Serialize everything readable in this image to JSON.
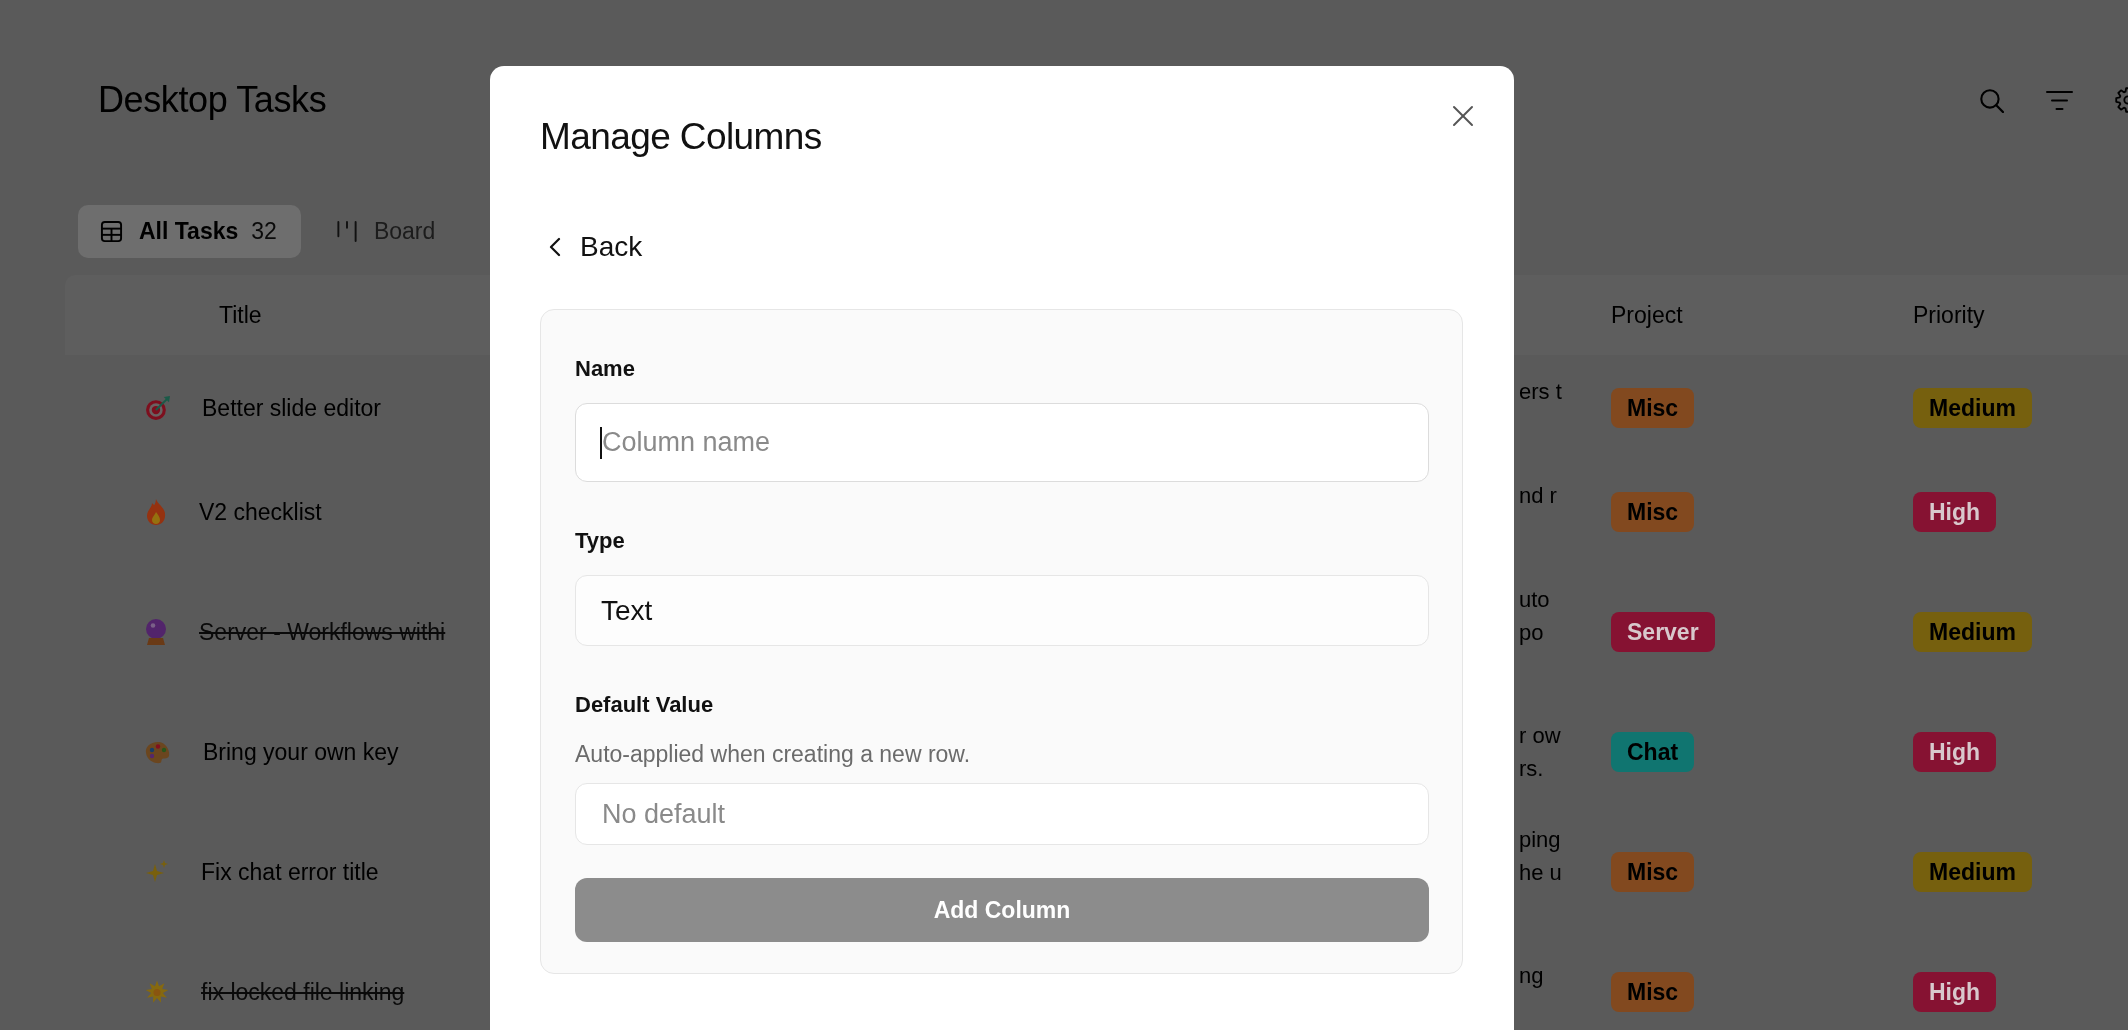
{
  "page": {
    "title": "Desktop Tasks"
  },
  "tabs": [
    {
      "kind": "table",
      "label": "All Tasks",
      "count": "32",
      "selected": true
    },
    {
      "kind": "board",
      "label": "Board",
      "selected": false
    }
  ],
  "table": {
    "columns": [
      {
        "label": "Title"
      },
      {
        "label": "Project"
      },
      {
        "label": "Priority"
      }
    ],
    "rows": [
      {
        "kind": "target",
        "title": "Better slide editor",
        "done": false,
        "column_2": [
          "ers t"
        ],
        "project": {
          "label": "Misc",
          "color": "#82491f"
        },
        "priority": {
          "label": "Medium",
          "color": "#76600e"
        }
      },
      {
        "kind": "flame",
        "title": "V2 checklist",
        "done": false,
        "column_2": [
          "nd r"
        ],
        "project": {
          "label": "Misc",
          "color": "#82491f"
        },
        "priority": {
          "label": "High",
          "color": "#861232"
        }
      },
      {
        "kind": "orb",
        "title": "Server - Workflows withi",
        "done": true,
        "column_2": [
          "uto",
          "po"
        ],
        "project": {
          "label": "Server",
          "color": "#861232"
        },
        "priority": {
          "label": "Medium",
          "color": "#76600e"
        }
      },
      {
        "kind": "palette",
        "title": "Bring your own key",
        "done": false,
        "column_2": [
          "r ow",
          "rs."
        ],
        "project": {
          "label": "Chat",
          "color": "#107570"
        },
        "priority": {
          "label": "High",
          "color": "#861232"
        }
      },
      {
        "kind": "sparkles",
        "title": "Fix chat error title",
        "done": false,
        "column_2": [
          "ping",
          "he u"
        ],
        "project": {
          "label": "Misc",
          "color": "#82491f"
        },
        "priority": {
          "label": "Medium",
          "color": "#76600e"
        }
      },
      {
        "kind": "burst",
        "title": "fix locked file linking",
        "done": true,
        "column_2": [
          "ng"
        ],
        "project": {
          "label": "Misc",
          "color": "#82491f"
        },
        "priority": {
          "label": "High",
          "color": "#861232"
        }
      }
    ]
  },
  "dialog": {
    "title": "Manage Columns",
    "back": "Back",
    "fields": [
      {
        "kind": "input",
        "label": "Name",
        "placeholder": "Column name",
        "focused": true
      },
      {
        "kind": "select",
        "label": "Type",
        "value": "Text"
      },
      {
        "kind": "input",
        "label": "Default Value",
        "hint": "Auto-applied when creating a new row.",
        "placeholder": "No default",
        "focused": false
      }
    ],
    "submit": {
      "label": "Add Column",
      "disabled": true
    }
  }
}
